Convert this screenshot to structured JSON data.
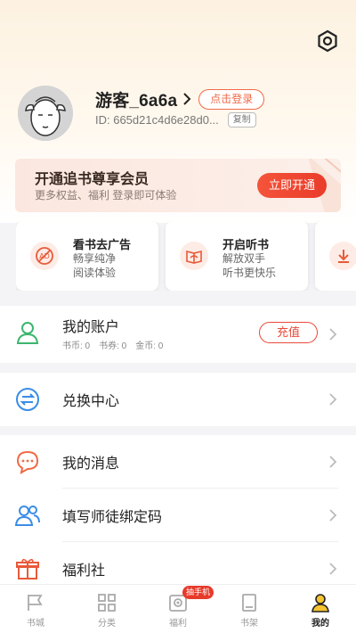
{
  "profile": {
    "username": "游客_6a6a",
    "login_label": "点击登录",
    "id_text": "ID: 665d21c4d6e28d0...",
    "copy_label": "复制"
  },
  "vip": {
    "title": "开通追书尊享会员",
    "subtitle": "更多权益、福利 登录即可体验",
    "button": "立即开通"
  },
  "cards": [
    {
      "title": "看书去广告",
      "line1": "畅享纯净",
      "line2": "阅读体验",
      "icon": "no-ads-icon"
    },
    {
      "title": "开启听书",
      "line1": "解放双手",
      "line2": "听书更快乐",
      "icon": "audiobook-icon"
    },
    {
      "icon": "download-icon"
    }
  ],
  "account": {
    "label": "我的账户",
    "book_coins": "书币: 0",
    "book_vouchers": "书券: 0",
    "gold_coins": "金币: 0",
    "recharge": "充值"
  },
  "menu": {
    "exchange": "兑换中心",
    "messages": "我的消息",
    "mentor_code": "填写师徒绑定码",
    "welfare_club": "福利社"
  },
  "tabs": [
    {
      "label": "书城",
      "icon": "bookstore-icon"
    },
    {
      "label": "分类",
      "icon": "category-icon"
    },
    {
      "label": "福利",
      "icon": "welfare-icon",
      "badge": "抽手机"
    },
    {
      "label": "书架",
      "icon": "bookshelf-icon"
    },
    {
      "label": "我的",
      "icon": "profile-icon",
      "active": true
    }
  ],
  "colors": {
    "accent": "#e84a3a",
    "orange": "#f06a47",
    "green": "#3cb66e",
    "blue": "#3a8de6"
  }
}
